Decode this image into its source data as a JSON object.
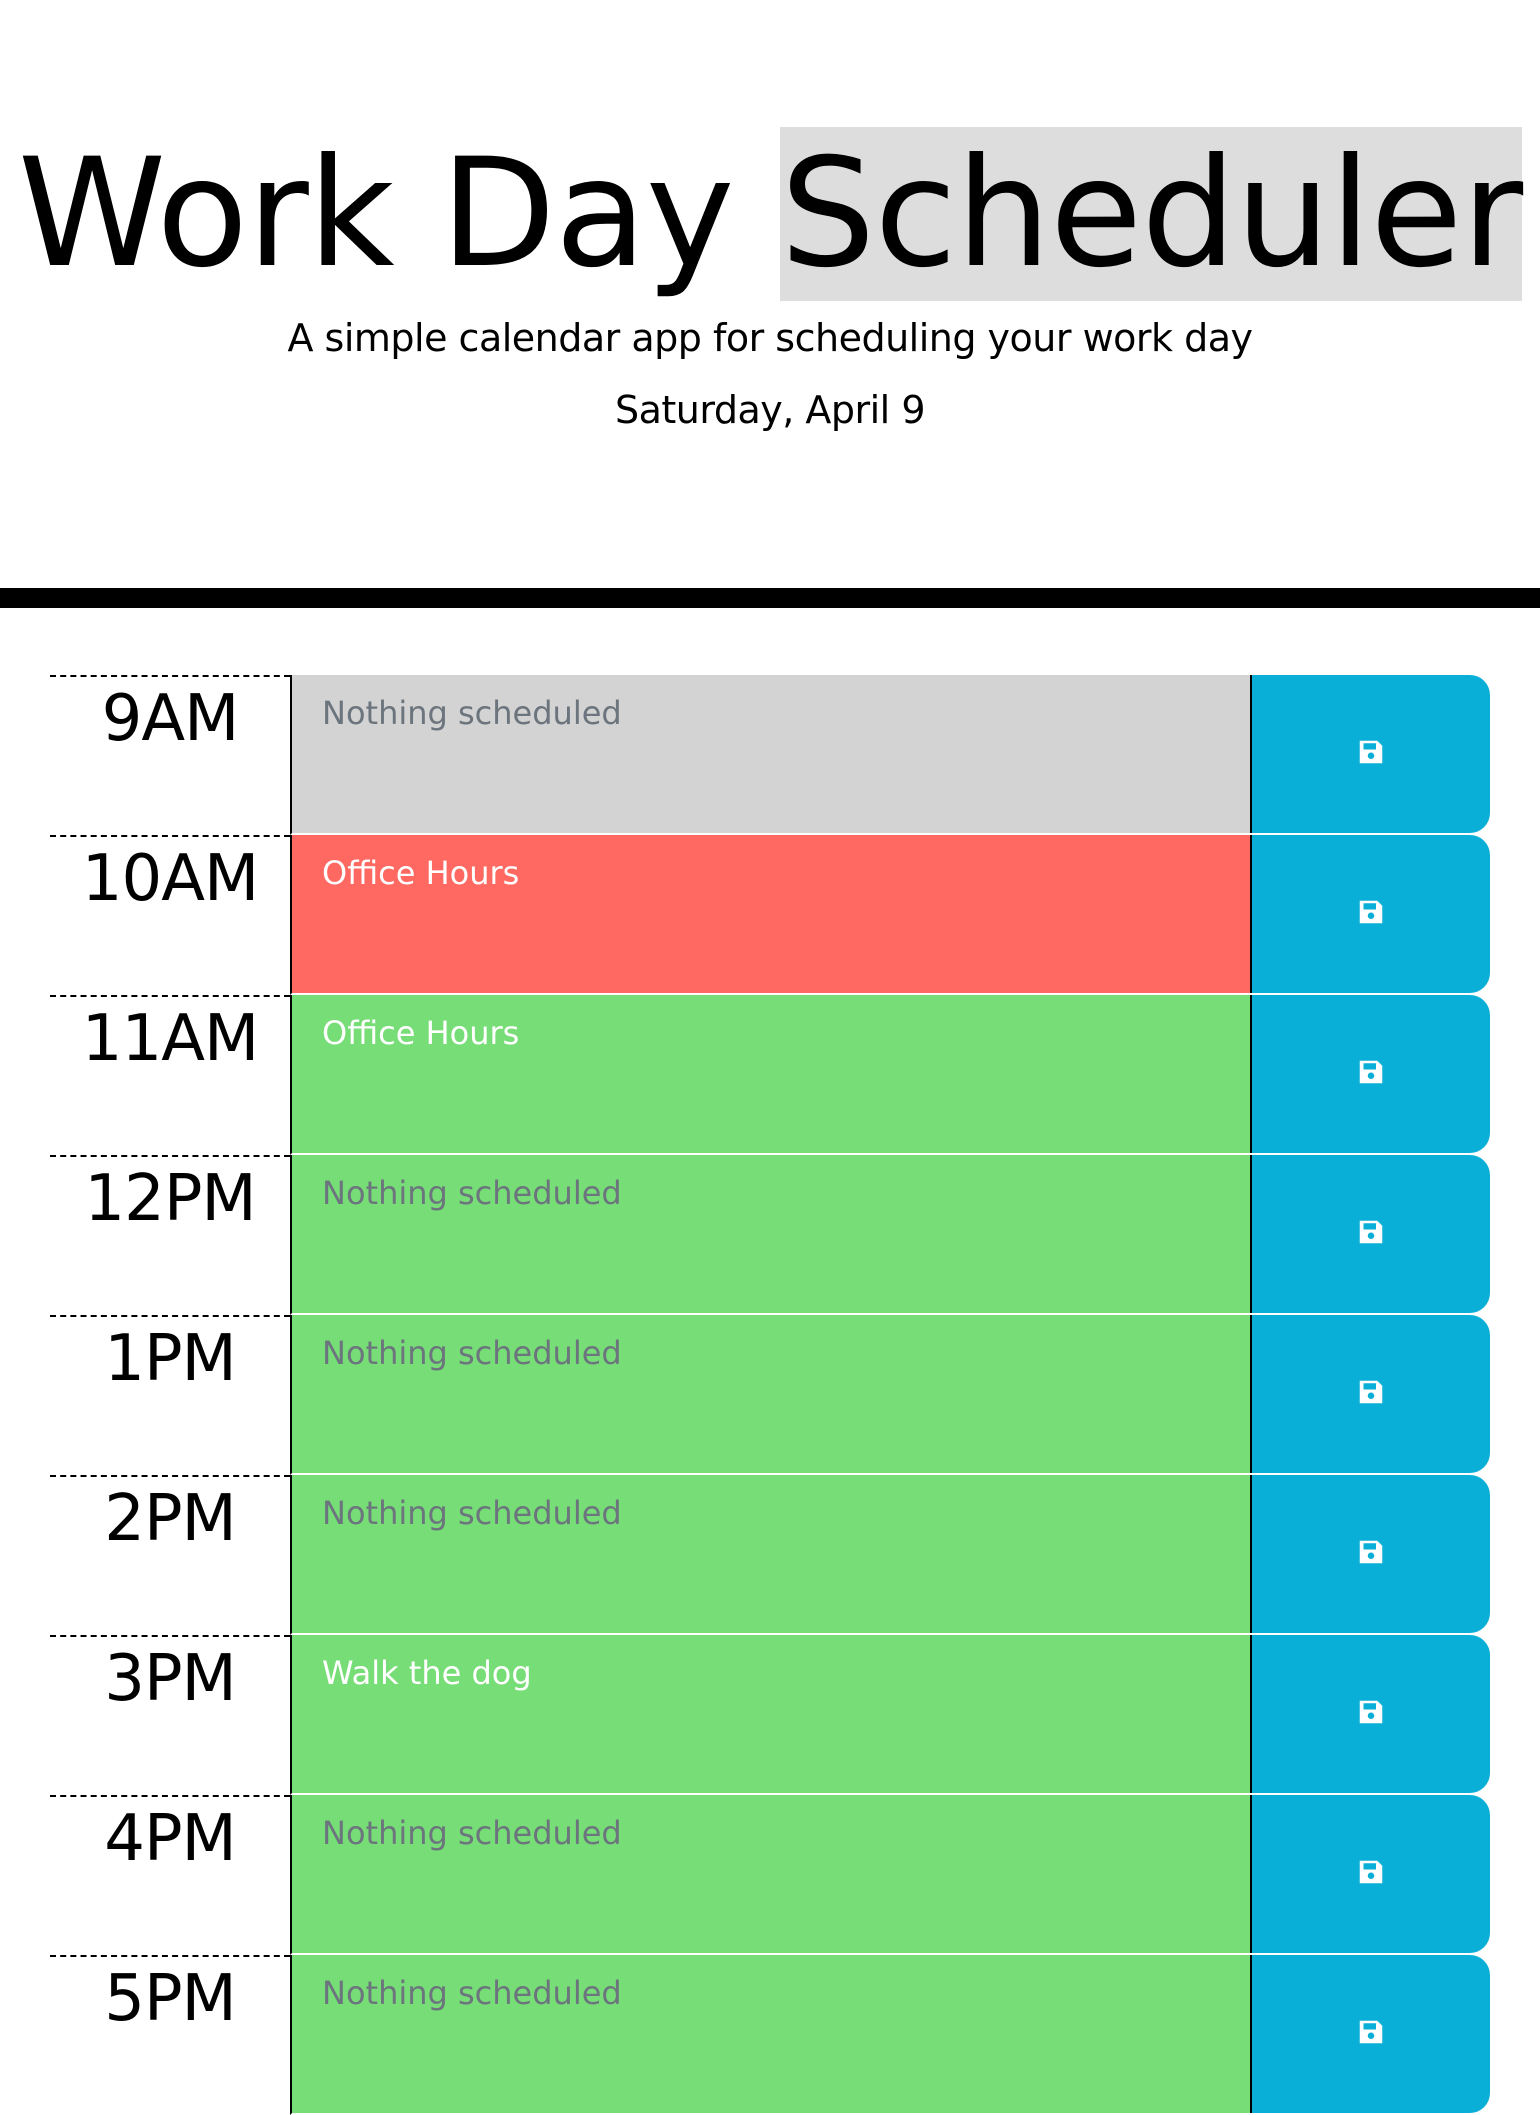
{
  "header": {
    "title_part1": "Work Day ",
    "title_part2": "Scheduler",
    "lead": "A simple calendar app for scheduling your work day",
    "current_day": "Saturday, April 9"
  },
  "colors": {
    "past": "#d3d3d3",
    "present": "#ff6961",
    "future": "#77dd77",
    "save_button": "#0aafd7"
  },
  "schedule": {
    "blocks": [
      {
        "hour": "9AM",
        "state": "past",
        "text": "",
        "placeholder": "Nothing scheduled",
        "save_icon": "floppy-disk-icon"
      },
      {
        "hour": "10AM",
        "state": "present",
        "text": "Office Hours",
        "placeholder": "Nothing scheduled",
        "save_icon": "floppy-disk-icon"
      },
      {
        "hour": "11AM",
        "state": "future",
        "text": "Office Hours",
        "placeholder": "Nothing scheduled",
        "save_icon": "floppy-disk-icon"
      },
      {
        "hour": "12PM",
        "state": "future",
        "text": "",
        "placeholder": "Nothing scheduled",
        "save_icon": "floppy-disk-icon"
      },
      {
        "hour": "1PM",
        "state": "future",
        "text": "",
        "placeholder": "Nothing scheduled",
        "save_icon": "floppy-disk-icon"
      },
      {
        "hour": "2PM",
        "state": "future",
        "text": "",
        "placeholder": "Nothing scheduled",
        "save_icon": "floppy-disk-icon"
      },
      {
        "hour": "3PM",
        "state": "future",
        "text": "Walk the dog",
        "placeholder": "Nothing scheduled",
        "save_icon": "floppy-disk-icon"
      },
      {
        "hour": "4PM",
        "state": "future",
        "text": "",
        "placeholder": "Nothing scheduled",
        "save_icon": "floppy-disk-icon"
      },
      {
        "hour": "5PM",
        "state": "future",
        "text": "",
        "placeholder": "Nothing scheduled",
        "save_icon": "floppy-disk-icon"
      }
    ]
  }
}
